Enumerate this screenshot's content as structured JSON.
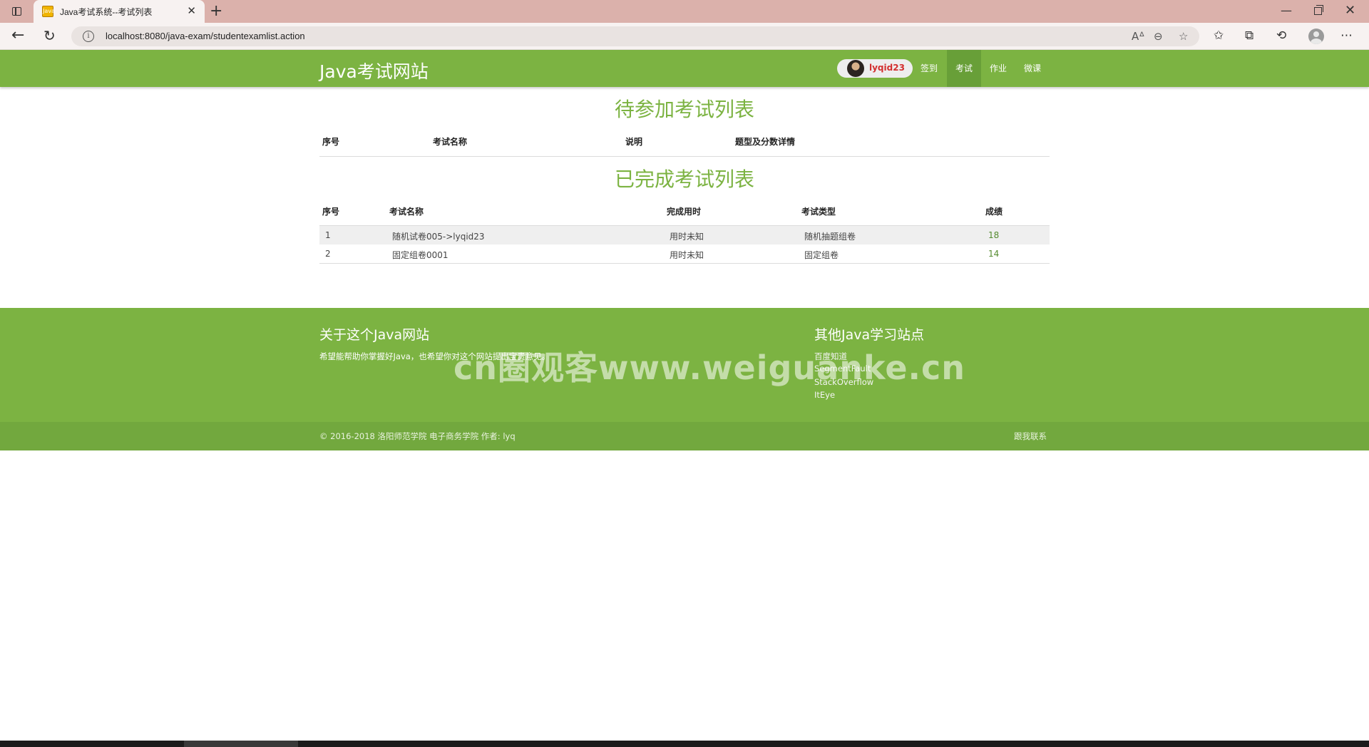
{
  "browser": {
    "tab_title": "Java考试系统--考试列表",
    "favicon_text": "Java",
    "url": "localhost:8080/java-exam/studentexamlist.action"
  },
  "header": {
    "brand": "Java考试网站",
    "username": "lyqid23",
    "nav": [
      {
        "label": "签到",
        "active": false
      },
      {
        "label": "考试",
        "active": true
      },
      {
        "label": "作业",
        "active": false
      },
      {
        "label": "微课",
        "active": false
      }
    ],
    "colors": {
      "primary": "#7cb342",
      "active_nav": "#689f38",
      "username": "#d32f2f"
    }
  },
  "pending": {
    "title": "待参加考试列表",
    "columns": [
      "序号",
      "考试名称",
      "说明",
      "题型及分数详情"
    ]
  },
  "completed": {
    "title": "已完成考试列表",
    "columns": [
      "序号",
      "考试名称",
      "完成用时",
      "考试类型",
      "成绩"
    ],
    "rows": [
      {
        "index": "1",
        "name": "随机试卷005->lyqid23",
        "duration": "用时未知",
        "type": "随机抽题组卷",
        "score": "18"
      },
      {
        "index": "2",
        "name": "固定组卷0001",
        "duration": "用时未知",
        "type": "固定组卷",
        "score": "14"
      }
    ]
  },
  "footer": {
    "about_title": "关于这个Java网站",
    "about_text": "希望能帮助你掌握好Java，也希望你对这个网站提出宝贵意见。",
    "links_title": "其他Java学习站点",
    "links": [
      "百度知道",
      "SegmentFault",
      "StackOverflow",
      "ItEye"
    ],
    "copyright": "© 2016-2018 洛阳师范学院 电子商务学院  作者: lyq",
    "contact": "跟我联系"
  },
  "watermark": "cn圈观客www.weiguanke.cn"
}
